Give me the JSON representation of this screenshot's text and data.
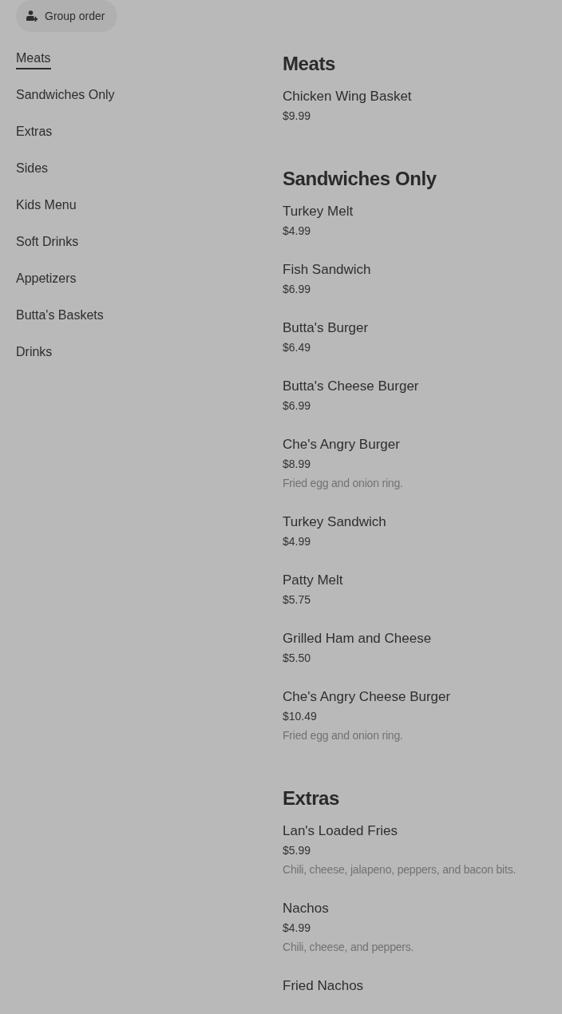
{
  "group_order_button": {
    "label": "Group order"
  },
  "category_nav": [
    {
      "label": "Meats",
      "selected": true
    },
    {
      "label": "Sandwiches Only",
      "selected": false
    },
    {
      "label": "Extras",
      "selected": false
    },
    {
      "label": "Sides",
      "selected": false
    },
    {
      "label": "Kids Menu",
      "selected": false
    },
    {
      "label": "Soft Drinks",
      "selected": false
    },
    {
      "label": "Appetizers",
      "selected": false
    },
    {
      "label": "Butta's Baskets",
      "selected": false
    },
    {
      "label": "Drinks",
      "selected": false
    }
  ],
  "menu_sections": [
    {
      "title": "Meats",
      "items": [
        {
          "name": "Chicken Wing Basket",
          "price": "$9.99"
        }
      ]
    },
    {
      "title": "Sandwiches Only",
      "items": [
        {
          "name": "Turkey Melt",
          "price": "$4.99"
        },
        {
          "name": "Fish Sandwich",
          "price": "$6.99"
        },
        {
          "name": "Butta's Burger",
          "price": "$6.49"
        },
        {
          "name": "Butta's Cheese Burger",
          "price": "$6.99"
        },
        {
          "name": "Che's Angry Burger",
          "price": "$8.99",
          "description": "Fried egg and onion ring."
        },
        {
          "name": "Turkey Sandwich",
          "price": "$4.99"
        },
        {
          "name": "Patty Melt",
          "price": "$5.75"
        },
        {
          "name": "Grilled Ham and Cheese",
          "price": "$5.50"
        },
        {
          "name": "Che's Angry Cheese Burger",
          "price": "$10.49",
          "description": "Fried egg and onion ring."
        }
      ]
    },
    {
      "title": "Extras",
      "items": [
        {
          "name": "Lan's Loaded Fries",
          "price": "$5.99",
          "description": "Chili, cheese, jalapeno, peppers, and bacon bits."
        },
        {
          "name": "Nachos",
          "price": "$4.99",
          "description": "Chili, cheese, and peppers."
        },
        {
          "name": "Fried Nachos"
        }
      ]
    }
  ]
}
